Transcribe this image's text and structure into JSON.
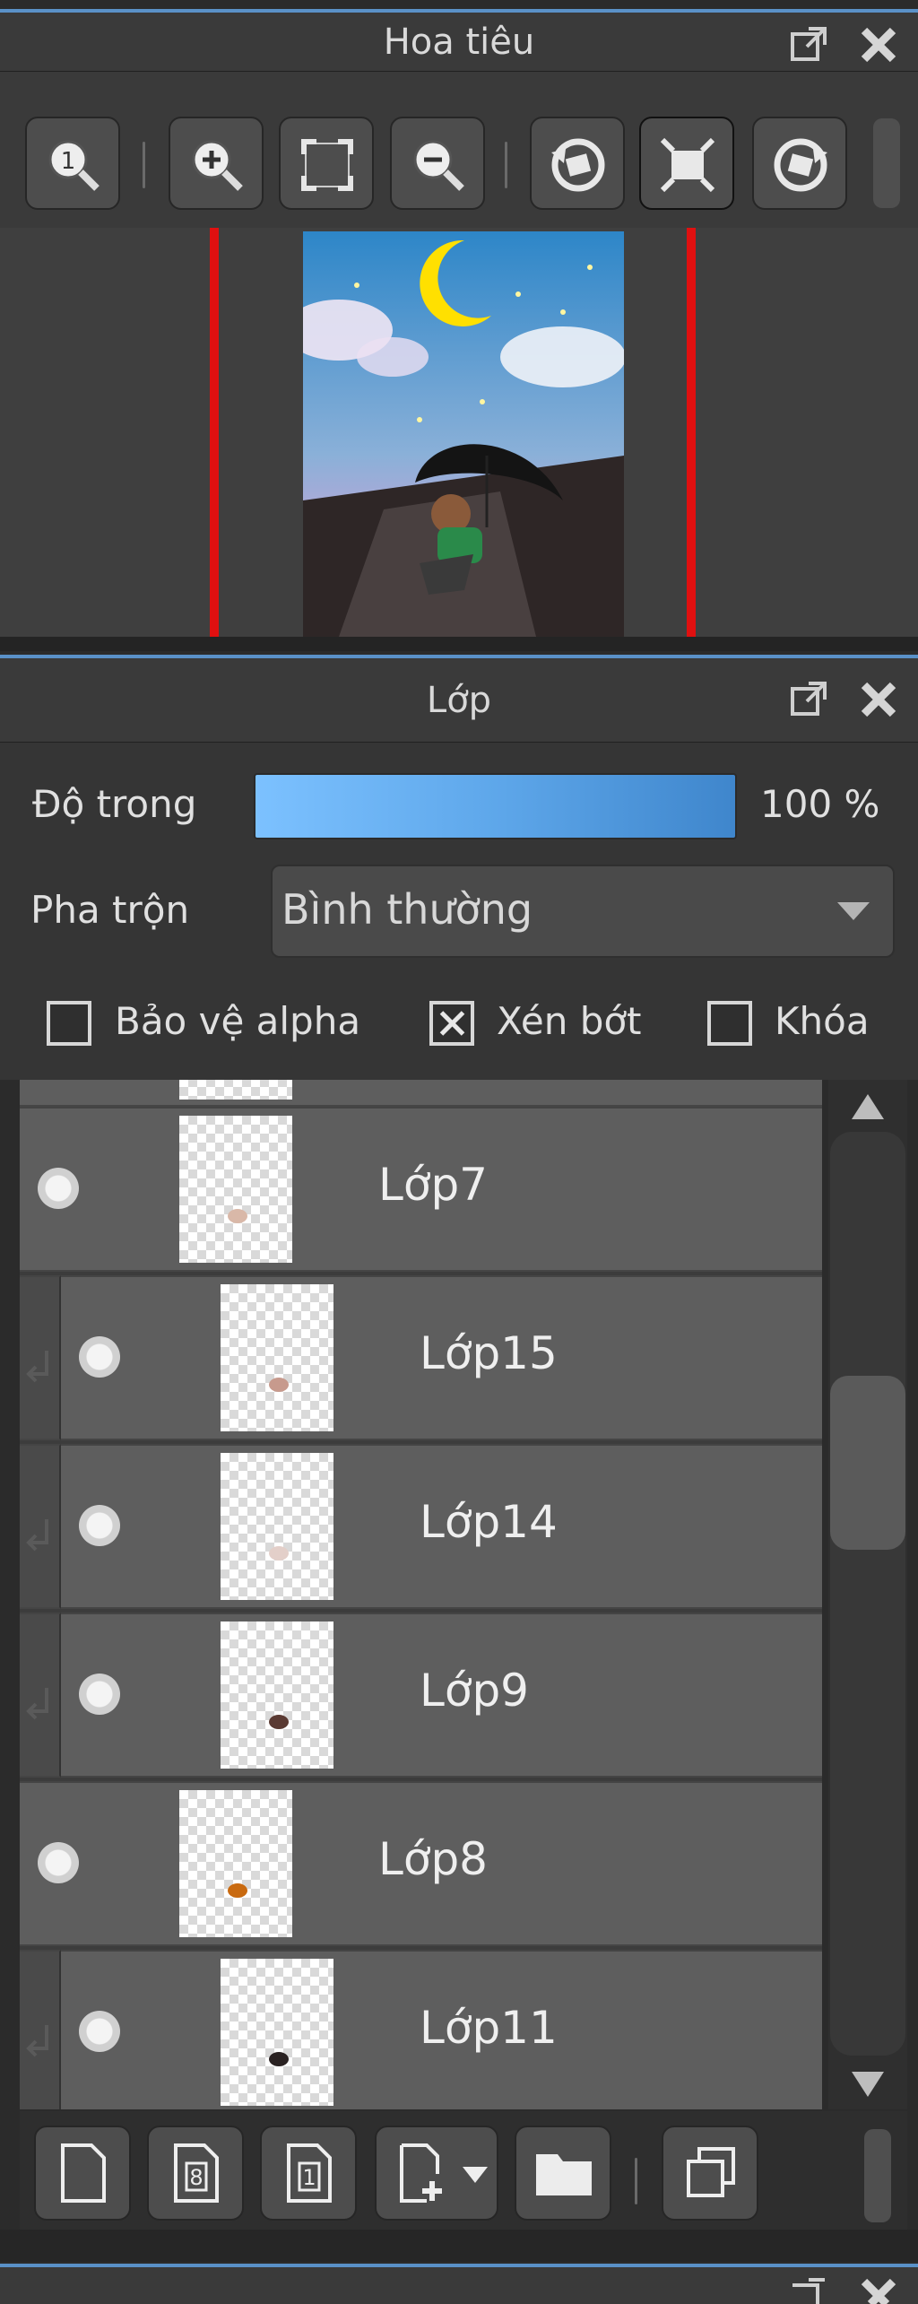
{
  "navigator": {
    "title": "Hoa tiêu",
    "toolbar": [
      "actual-size",
      "zoom-in",
      "fit",
      "zoom-out",
      "rotate-left",
      "fullscreen",
      "rotate-right"
    ],
    "preview_colors": {
      "sky_top": "#2d86c8",
      "sky_bottom": "#c8a5d8",
      "ground": "#2e2626",
      "moon": "#ffe000"
    }
  },
  "layers": {
    "title": "Lớp",
    "opacity_label": "Độ trong",
    "opacity_value": "100 %",
    "opacity": 1.0,
    "blend_label": "Pha trộn",
    "blend_value": "Bình thường",
    "checks": {
      "alpha_label": "Bảo vệ alpha",
      "alpha": false,
      "clip_label": "Xén bớt",
      "clip": true,
      "lock_label": "Khóa",
      "lock": false
    },
    "rows": [
      {
        "name": "Lớp7",
        "clipped": false,
        "mark": "#d9b8a8"
      },
      {
        "name": "Lớp15",
        "clipped": true,
        "mark": "#c79a8d"
      },
      {
        "name": "Lớp14",
        "clipped": true,
        "mark": "#e3cfc9"
      },
      {
        "name": "Lớp9",
        "clipped": true,
        "mark": "#5a3a33"
      },
      {
        "name": "Lớp8",
        "clipped": false,
        "mark": "#c96a10"
      },
      {
        "name": "Lớp11",
        "clipped": true,
        "mark": "#2a2222"
      }
    ]
  },
  "bottom_toolbar": [
    "new-layer",
    "new-8bit-layer",
    "new-1bit-layer",
    "add-layer-menu",
    "new-folder",
    "duplicate-layer"
  ],
  "accent": "#5a91c8"
}
